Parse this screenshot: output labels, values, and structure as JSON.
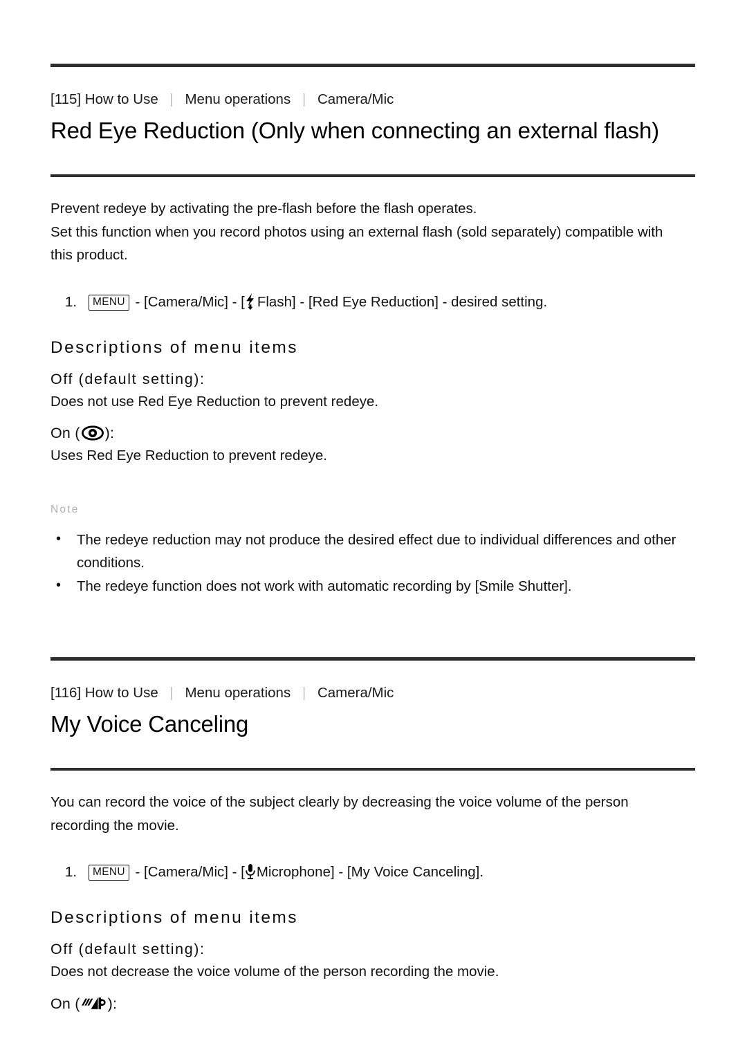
{
  "sections": [
    {
      "breadcrumb": {
        "id": "[115]",
        "items": [
          "How to Use",
          "Menu operations",
          "Camera/Mic"
        ]
      },
      "title": "Red Eye Reduction (Only when connecting an external flash)",
      "paragraphs": [
        "Prevent redeye by activating the pre-flash before the flash operates.",
        "Set this function when you record photos using an external flash (sold separately) compatible with this product."
      ],
      "step": {
        "number": "1.",
        "menu_label": "MENU",
        "before_icon": " - [Camera/Mic] - [",
        "icon": "flash-icon",
        "after_icon": "Flash] - [Red Eye Reduction] - desired setting."
      },
      "descriptions_heading": "Descriptions of menu items",
      "options": [
        {
          "label": "Off (default setting):",
          "icon": null,
          "description": "Does not use Red Eye Reduction to prevent redeye."
        },
        {
          "label_prefix": "On (",
          "label_suffix": "):",
          "icon": "eye-icon",
          "description": "Uses Red Eye Reduction to prevent redeye."
        }
      ],
      "note": {
        "label": "Note",
        "items": [
          "The redeye reduction may not produce the desired effect due to individual differences and other conditions.",
          "The redeye function does not work with automatic recording by [Smile Shutter]."
        ]
      }
    },
    {
      "breadcrumb": {
        "id": "[116]",
        "items": [
          "How to Use",
          "Menu operations",
          "Camera/Mic"
        ]
      },
      "title": "My Voice Canceling",
      "paragraphs": [
        "You can record the voice of the subject clearly by decreasing the voice volume of the person recording the movie."
      ],
      "step": {
        "number": "1.",
        "menu_label": "MENU",
        "before_icon": " - [Camera/Mic] - [",
        "icon": "microphone-icon",
        "after_icon": "Microphone] - [My Voice Canceling]."
      },
      "descriptions_heading": "Descriptions of menu items",
      "options": [
        {
          "label": "Off (default setting):",
          "icon": null,
          "description": "Does not decrease the voice volume of the person recording the movie."
        },
        {
          "label_prefix": "On (",
          "label_suffix": "):",
          "icon": "voice-canceling-icon",
          "description": ""
        }
      ]
    }
  ],
  "colors": {
    "rule": "#2e2e2e",
    "text": "#121212",
    "note_label": "#b0b0b0",
    "separator": "#9a9a9a"
  }
}
